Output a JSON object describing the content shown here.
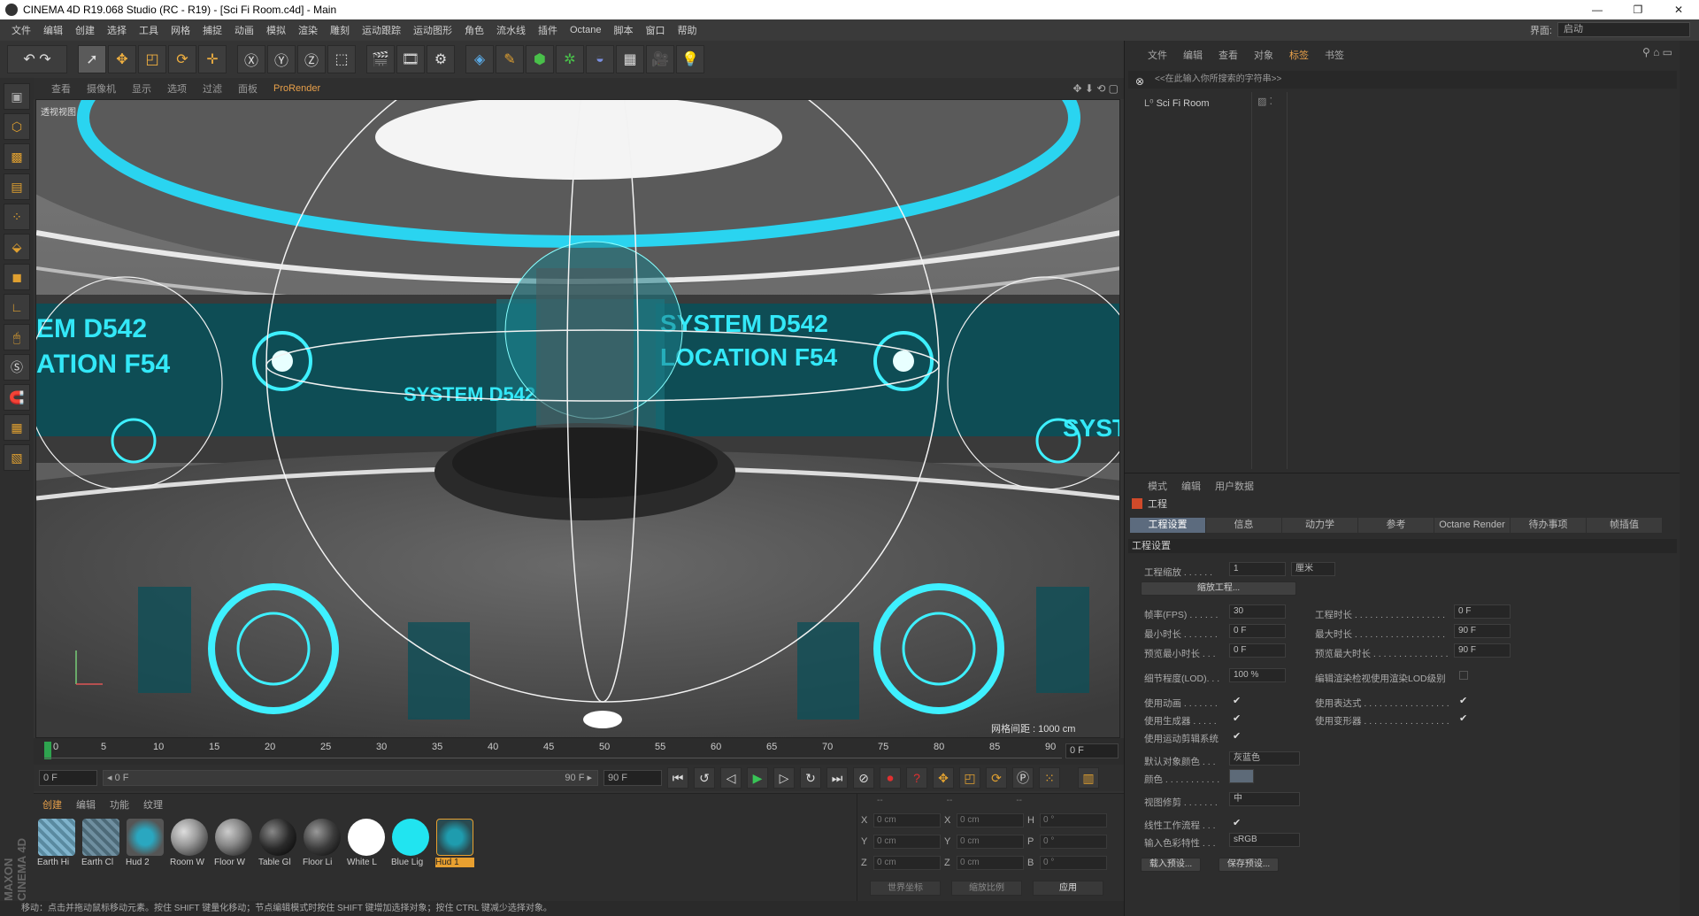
{
  "title": "CINEMA 4D R19.068 Studio (RC - R19) - [Sci Fi Room.c4d] - Main",
  "window_buttons": [
    "—",
    "❐",
    "✕"
  ],
  "menu": [
    "文件",
    "编辑",
    "创建",
    "选择",
    "工具",
    "网格",
    "捕捉",
    "动画",
    "模拟",
    "渲染",
    "雕刻",
    "运动跟踪",
    "运动图形",
    "角色",
    "流水线",
    "插件",
    "Octane",
    "脚本",
    "窗口",
    "帮助"
  ],
  "layout_label": "界面:",
  "layout_value": "启动",
  "viewport": {
    "menu": [
      "查看",
      "摄像机",
      "显示",
      "选项",
      "过滤",
      "面板",
      "ProRender"
    ],
    "label": "透视视图",
    "grid_info": "网格间距 : 1000 cm",
    "hud_texts": [
      "EM D542",
      "ATION F54",
      "SYSTEM D542",
      "LOCATION F54",
      "SYSTEM D542",
      "SYSTE"
    ]
  },
  "timeline": {
    "ticks": [
      "0",
      "5",
      "10",
      "15",
      "20",
      "25",
      "30",
      "35",
      "40",
      "45",
      "50",
      "55",
      "60",
      "65",
      "70",
      "75",
      "80",
      "85",
      "90"
    ],
    "current_frame": "0 F"
  },
  "transport": {
    "start": "0 F",
    "range_start": "◂ 0 F",
    "range_end": "90 F ▸",
    "end": "90 F"
  },
  "materials": {
    "menu": [
      "创建",
      "编辑",
      "功能",
      "纹理"
    ],
    "items": [
      {
        "label": "Earth Hi",
        "color": "#7fb3cc"
      },
      {
        "label": "Earth Cl",
        "color": "#6f8fa0"
      },
      {
        "label": "Hud 2",
        "color": "#2aa7c0"
      },
      {
        "label": "Room W",
        "color": "#9a9a9a"
      },
      {
        "label": "Floor W",
        "color": "#8a8a8a"
      },
      {
        "label": "Table Gl",
        "color": "#2a2a2a"
      },
      {
        "label": "Floor Li",
        "color": "#3c3c3c"
      },
      {
        "label": "White L",
        "color": "#ffffff"
      },
      {
        "label": "Blue Lig",
        "color": "#21e4f0"
      },
      {
        "label": "Hud 1",
        "color": "#1f9cae"
      }
    ]
  },
  "coords": {
    "header": [
      "--",
      "--",
      "--"
    ],
    "rows": [
      {
        "a": "X",
        "v1": "0 cm",
        "b": "X",
        "v2": "0 cm",
        "c": "H",
        "v3": "0 °"
      },
      {
        "a": "Y",
        "v1": "0 cm",
        "b": "Y",
        "v2": "0 cm",
        "c": "P",
        "v3": "0 °"
      },
      {
        "a": "Z",
        "v1": "0 cm",
        "b": "Z",
        "v2": "0 cm",
        "c": "B",
        "v3": "0 °"
      }
    ],
    "btn_world": "世界坐标",
    "btn_scale": "缩放比例",
    "btn_apply": "应用"
  },
  "status": "移动：点击并拖动鼠标移动元素。按住 SHIFT 键量化移动；节点编辑模式时按住 SHIFT 键增加选择对象；按住 CTRL 键减少选择对象。",
  "brand": "MAXON CINEMA 4D",
  "object_manager": {
    "menu": [
      "文件",
      "编辑",
      "查看",
      "对象",
      "标签",
      "书签"
    ],
    "search": "<<在此输入你所搜索的字符串>>",
    "object": "Sci Fi Room"
  },
  "attributes": {
    "menu": [
      "模式",
      "编辑",
      "用户数据"
    ],
    "title": "工程",
    "tabs": [
      "工程设置",
      "信息",
      "动力学",
      "参考",
      "Octane Render",
      "待办事项",
      "帧插值"
    ],
    "section": "工程设置",
    "scale_label": "工程缩放 . . . . . .",
    "scale_value": "1",
    "scale_unit": "厘米",
    "scale_button": "缩放工程...",
    "fps_label": "帧率(FPS) . . . . . .",
    "fps": "30",
    "time_label": "工程时长 . . . . . . . . . . . . . . . . . .",
    "time": "0 F",
    "min_label": "最小时长 . . . . . . .",
    "min": "0 F",
    "max_label": "最大时长 . . . . . . . . . . . . . . . . . .",
    "max": "90 F",
    "pmin_label": "预览最小时长 . . .",
    "pmin": "0 F",
    "pmax_label": "预览最大时长 . . . . . . . . . . . . . . .",
    "pmax": "90 F",
    "lod_label": "细节程度(LOD). . .",
    "lod": "100 %",
    "lod_render_label": "编辑渲染检视使用渲染LOD级别",
    "use_anim": "使用动画 . . . . . . .",
    "use_expr": "使用表达式 . . . . . . . . . . . . . . . . .",
    "use_gen": "使用生成器 . . . . .",
    "use_deform": "使用变形器 . . . . . . . . . . . . . . . . .",
    "use_motion": "使用运动剪辑系统",
    "default_color_label": "默认对象颜色 . . .",
    "default_color": "灰蓝色",
    "color_label": "颜色 . . . . . . . . . . .",
    "clip_label": "视图修剪 . . . . . . .",
    "clip": "中",
    "linear_label": "线性工作流程 . . .",
    "input_color_label": "输入色彩特性 . . .",
    "input_color": "sRGB",
    "load_preset": "载入预设...",
    "save_preset": "保存预设..."
  }
}
